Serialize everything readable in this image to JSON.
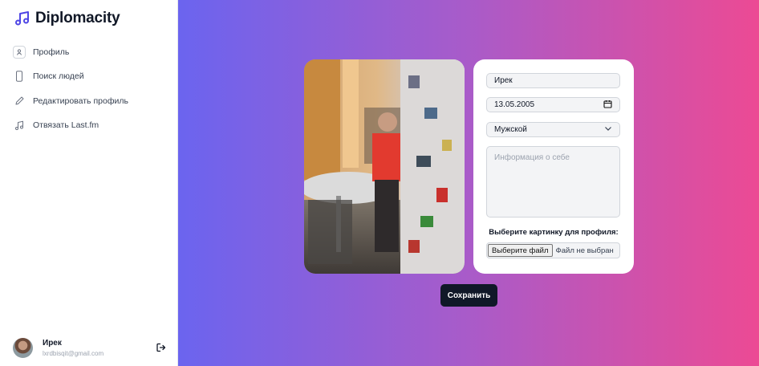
{
  "app": {
    "name": "Diplomacity",
    "logo_icon": "music-note-icon"
  },
  "sidebar": {
    "items": [
      {
        "label": "Профиль",
        "icon": "profile-icon"
      },
      {
        "label": "Поиск людей",
        "icon": "phone-icon"
      },
      {
        "label": "Редактировать профиль",
        "icon": "pencil-icon"
      },
      {
        "label": "Отвязать Last.fm",
        "icon": "music-note-icon"
      }
    ]
  },
  "user": {
    "name": "Ирек",
    "email": "lxrdbisqit@gmail.com"
  },
  "form": {
    "first_name": "Ирек",
    "birth_date": "13.05.2005",
    "gender": "Мужской",
    "about_placeholder": "Информация о себе",
    "file_label": "Выберите картинку для профиля:",
    "file_button": "Выберите файл",
    "file_status": "Файл не выбран",
    "save_button": "Сохранить"
  },
  "colors": {
    "accent_dark": "#101828",
    "gradient_start": "#6b64ef",
    "gradient_end": "#ec4a94",
    "logo": "#4f46e5"
  }
}
